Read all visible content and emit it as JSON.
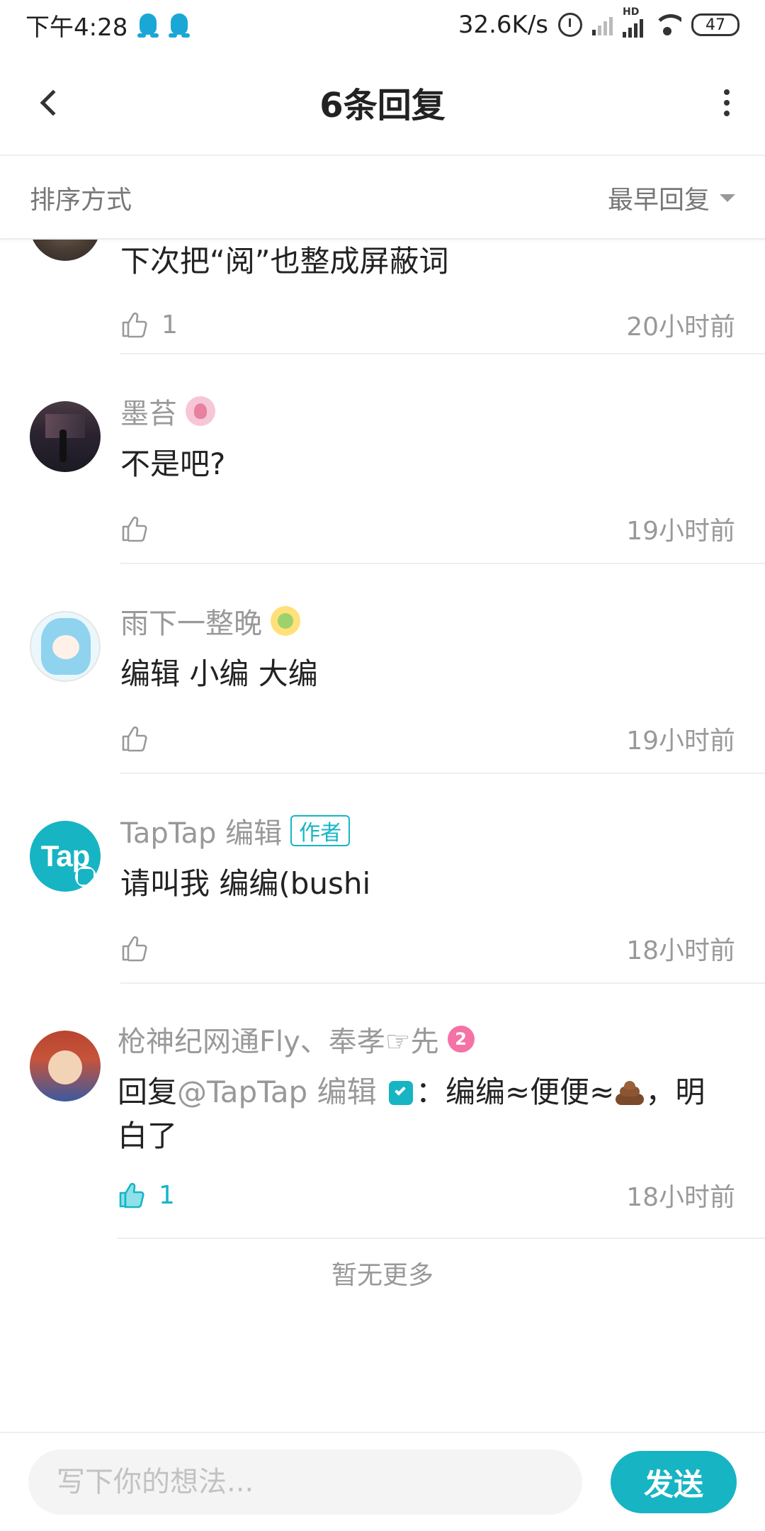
{
  "status_bar": {
    "time": "下午4:28",
    "net_speed": "32.6K/s",
    "battery": "47",
    "hd_label": "HD"
  },
  "header": {
    "title": "6条回复"
  },
  "sort": {
    "label": "排序方式",
    "selected": "最早回复"
  },
  "replies": [
    {
      "username": "",
      "content": "下次把“阅”也整成屏蔽词",
      "likes": "1",
      "time": "20小时前"
    },
    {
      "username": "墨苔",
      "content": "不是吧?",
      "likes": "",
      "time": "19小时前"
    },
    {
      "username": "雨下一整晚",
      "content": "编辑 小编 大编",
      "likes": "",
      "time": "19小时前"
    },
    {
      "username": "TapTap 编辑",
      "author_tag": "作者",
      "avatar_text": "Tap",
      "content": "请叫我 编编(bushi",
      "likes": "",
      "time": "18小时前"
    },
    {
      "username": "枪神纪网通Fly、奉孝☞先",
      "level_badge": "2",
      "content_prefix": "回复",
      "mention": "@TapTap 编辑",
      "content": "：编编≈便便≈",
      "content_suffix": "，明白了",
      "likes": "1",
      "time": "18小时前"
    }
  ],
  "footer": {
    "no_more": "暂无更多"
  },
  "composer": {
    "placeholder": "写下你的想法...",
    "send_label": "发送"
  },
  "colors": {
    "accent": "#17b4c3",
    "muted": "#999999"
  }
}
